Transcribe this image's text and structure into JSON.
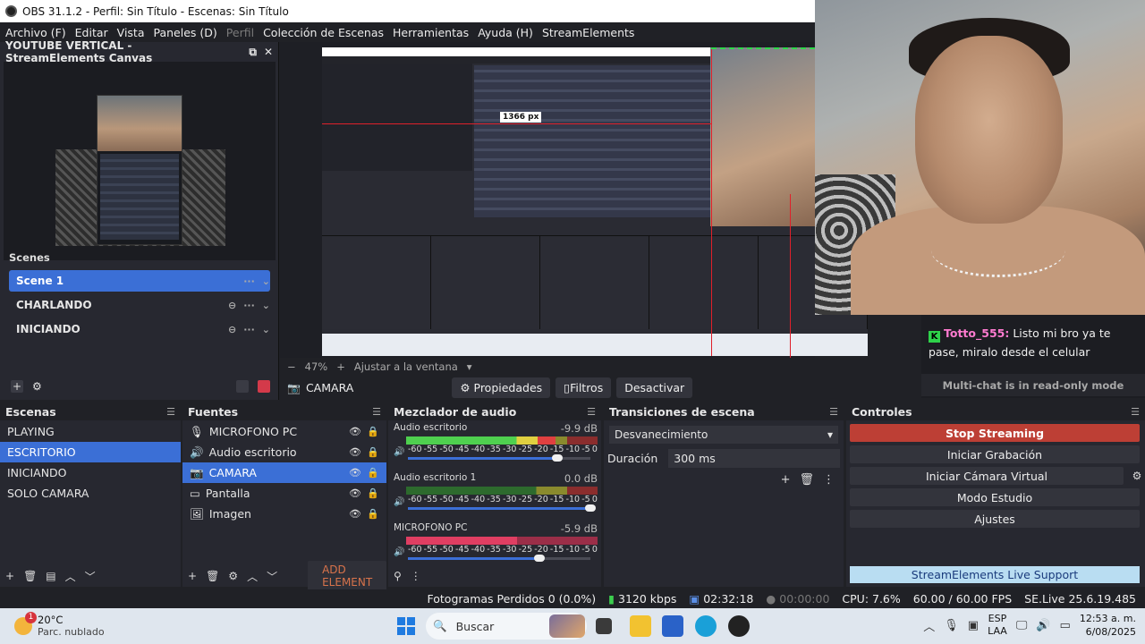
{
  "window": {
    "title": "OBS 31.1.2 - Perfil: Sin Título - Escenas: Sin Título"
  },
  "menu": [
    {
      "label": "Archivo (F)",
      "enabled": true
    },
    {
      "label": "Editar",
      "enabled": true
    },
    {
      "label": "Vista",
      "enabled": true
    },
    {
      "label": "Paneles (D)",
      "enabled": true
    },
    {
      "label": "Perfil",
      "enabled": false
    },
    {
      "label": "Colección de Escenas",
      "enabled": true
    },
    {
      "label": "Herramientas",
      "enabled": true
    },
    {
      "label": "Ayuda (H)",
      "enabled": true
    },
    {
      "label": "StreamElements",
      "enabled": true
    }
  ],
  "canvas_dock": {
    "title": "YOUTUBE VERTICAL - StreamElements Canvas",
    "scenes_label": "Scenes",
    "scenes": [
      "Scene 1",
      "CHARLANDO",
      "INICIANDO"
    ],
    "active_scene": 0
  },
  "preview": {
    "measure_label": "1366 px"
  },
  "chat": {
    "user": "Totto_555:",
    "message": "Listo mi bro ya te pase, miralo desde el celular",
    "read_only": "Multi-chat is in read-only mode"
  },
  "preview_controls": {
    "zoom": "47%",
    "fit_label": "Ajustar a la ventana",
    "source_name": "CAMARA",
    "properties": "Propiedades",
    "filters": "Filtros",
    "deactivate": "Desactivar"
  },
  "scenes_dock": {
    "title": "Escenas",
    "items": [
      "PLAYING",
      "ESCRITORIO",
      "INICIANDO",
      "SOLO CAMARA"
    ],
    "active": 1
  },
  "sources_dock": {
    "title": "Fuentes",
    "items": [
      {
        "label": "MICROFONO PC",
        "icon": "microphone-icon"
      },
      {
        "label": "Audio escritorio",
        "icon": "speaker-icon"
      },
      {
        "label": "CAMARA",
        "icon": "camera-icon"
      },
      {
        "label": "Pantalla",
        "icon": "monitor-icon"
      },
      {
        "label": "Imagen",
        "icon": "image-icon"
      }
    ],
    "active": 2,
    "add_element": "ADD ELEMENT"
  },
  "mixer": {
    "title": "Mezclador de audio",
    "scale": [
      "-60",
      "-55",
      "-50",
      "-45",
      "-40",
      "-35",
      "-30",
      "-25",
      "-20",
      "-15",
      "-10",
      "-5",
      "0"
    ],
    "channels": [
      {
        "name": "Audio escritorio",
        "db": "-9.9 dB",
        "level": 0.78,
        "volume": 0.82,
        "muted": false
      },
      {
        "name": "Audio escritorio 1",
        "db": "0.0 dB",
        "level": 0.0,
        "volume": 1.0,
        "muted": false
      },
      {
        "name": "MICROFONO PC",
        "db": "-5.9 dB",
        "level": 0.58,
        "volume": 0.72,
        "muted": true
      }
    ]
  },
  "transitions": {
    "title": "Transiciones de escena",
    "selected": "Desvanecimiento",
    "duration_label": "Duración",
    "duration_value": "300 ms"
  },
  "controls": {
    "title": "Controles",
    "stop_streaming": "Stop Streaming",
    "start_recording": "Iniciar Grabación",
    "virtual_camera": "Iniciar Cámara Virtual",
    "studio_mode": "Modo Estudio",
    "settings": "Ajustes",
    "se_support": "StreamElements Live Support"
  },
  "status": {
    "dropped_frames": "Fotogramas Perdidos 0 (0.0%)",
    "bitrate": "3120 kbps",
    "stream_time": "02:32:18",
    "record_time": "00:00:00",
    "cpu": "CPU: 7.6%",
    "fps": "60.00 / 60.00 FPS",
    "se_version": "SE.Live 25.6.19.485"
  },
  "taskbar": {
    "weather_temp": "20°C",
    "weather_desc": "Parc. nublado",
    "weather_badge": "1",
    "search_placeholder": "Buscar",
    "lang_line1": "ESP",
    "lang_line2": "LAA",
    "time": "12:53 a. m.",
    "date": "6/08/2025"
  },
  "colors": {
    "accent": "#3b6fd6",
    "stop": "#bd3f35",
    "chat_user": "#ff7bd0"
  }
}
